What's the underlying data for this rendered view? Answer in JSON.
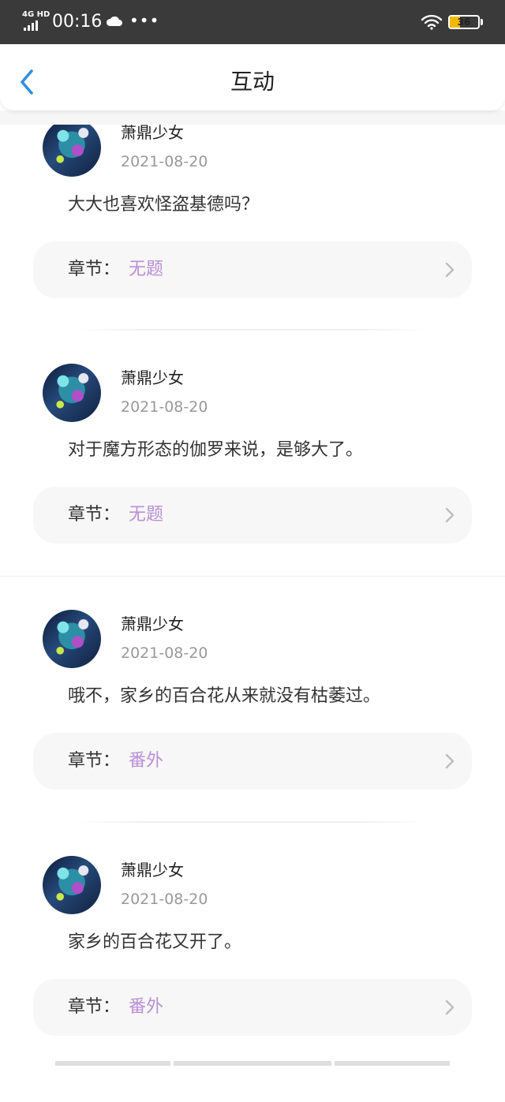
{
  "status_bar": {
    "network": "4G HD",
    "time": "00:16",
    "more": "•••",
    "battery": "36",
    "battery_level": 0.36,
    "icons": [
      "signal-icon",
      "cloud-icon",
      "wifi-icon",
      "battery-icon"
    ]
  },
  "header": {
    "title": "互动",
    "back_icon": "chevron-left-icon",
    "accent_color": "#2f8fe0"
  },
  "interactions": [
    {
      "username": "萧鼎少女",
      "date": "2021-08-20",
      "comment": "大大也喜欢怪盗基德吗？",
      "chapter_label": "章节：",
      "chapter_name": "无题"
    },
    {
      "username": "萧鼎少女",
      "date": "2021-08-20",
      "comment": "对于魔方形态的伽罗来说，是够大了。",
      "chapter_label": "章节：",
      "chapter_name": "无题"
    },
    {
      "username": "萧鼎少女",
      "date": "2021-08-20",
      "comment": "哦不，家乡的百合花从来就没有枯萎过。",
      "chapter_label": "章节：",
      "chapter_name": "番外"
    },
    {
      "username": "萧鼎少女",
      "date": "2021-08-20",
      "comment": "家乡的百合花又开了。",
      "chapter_label": "章节：",
      "chapter_name": "番外"
    }
  ],
  "colors": {
    "chapter_name": "#b98fd6",
    "date": "#999999",
    "status_bar_bg": "#3a3a3a",
    "battery_fill": "#f5b800"
  }
}
